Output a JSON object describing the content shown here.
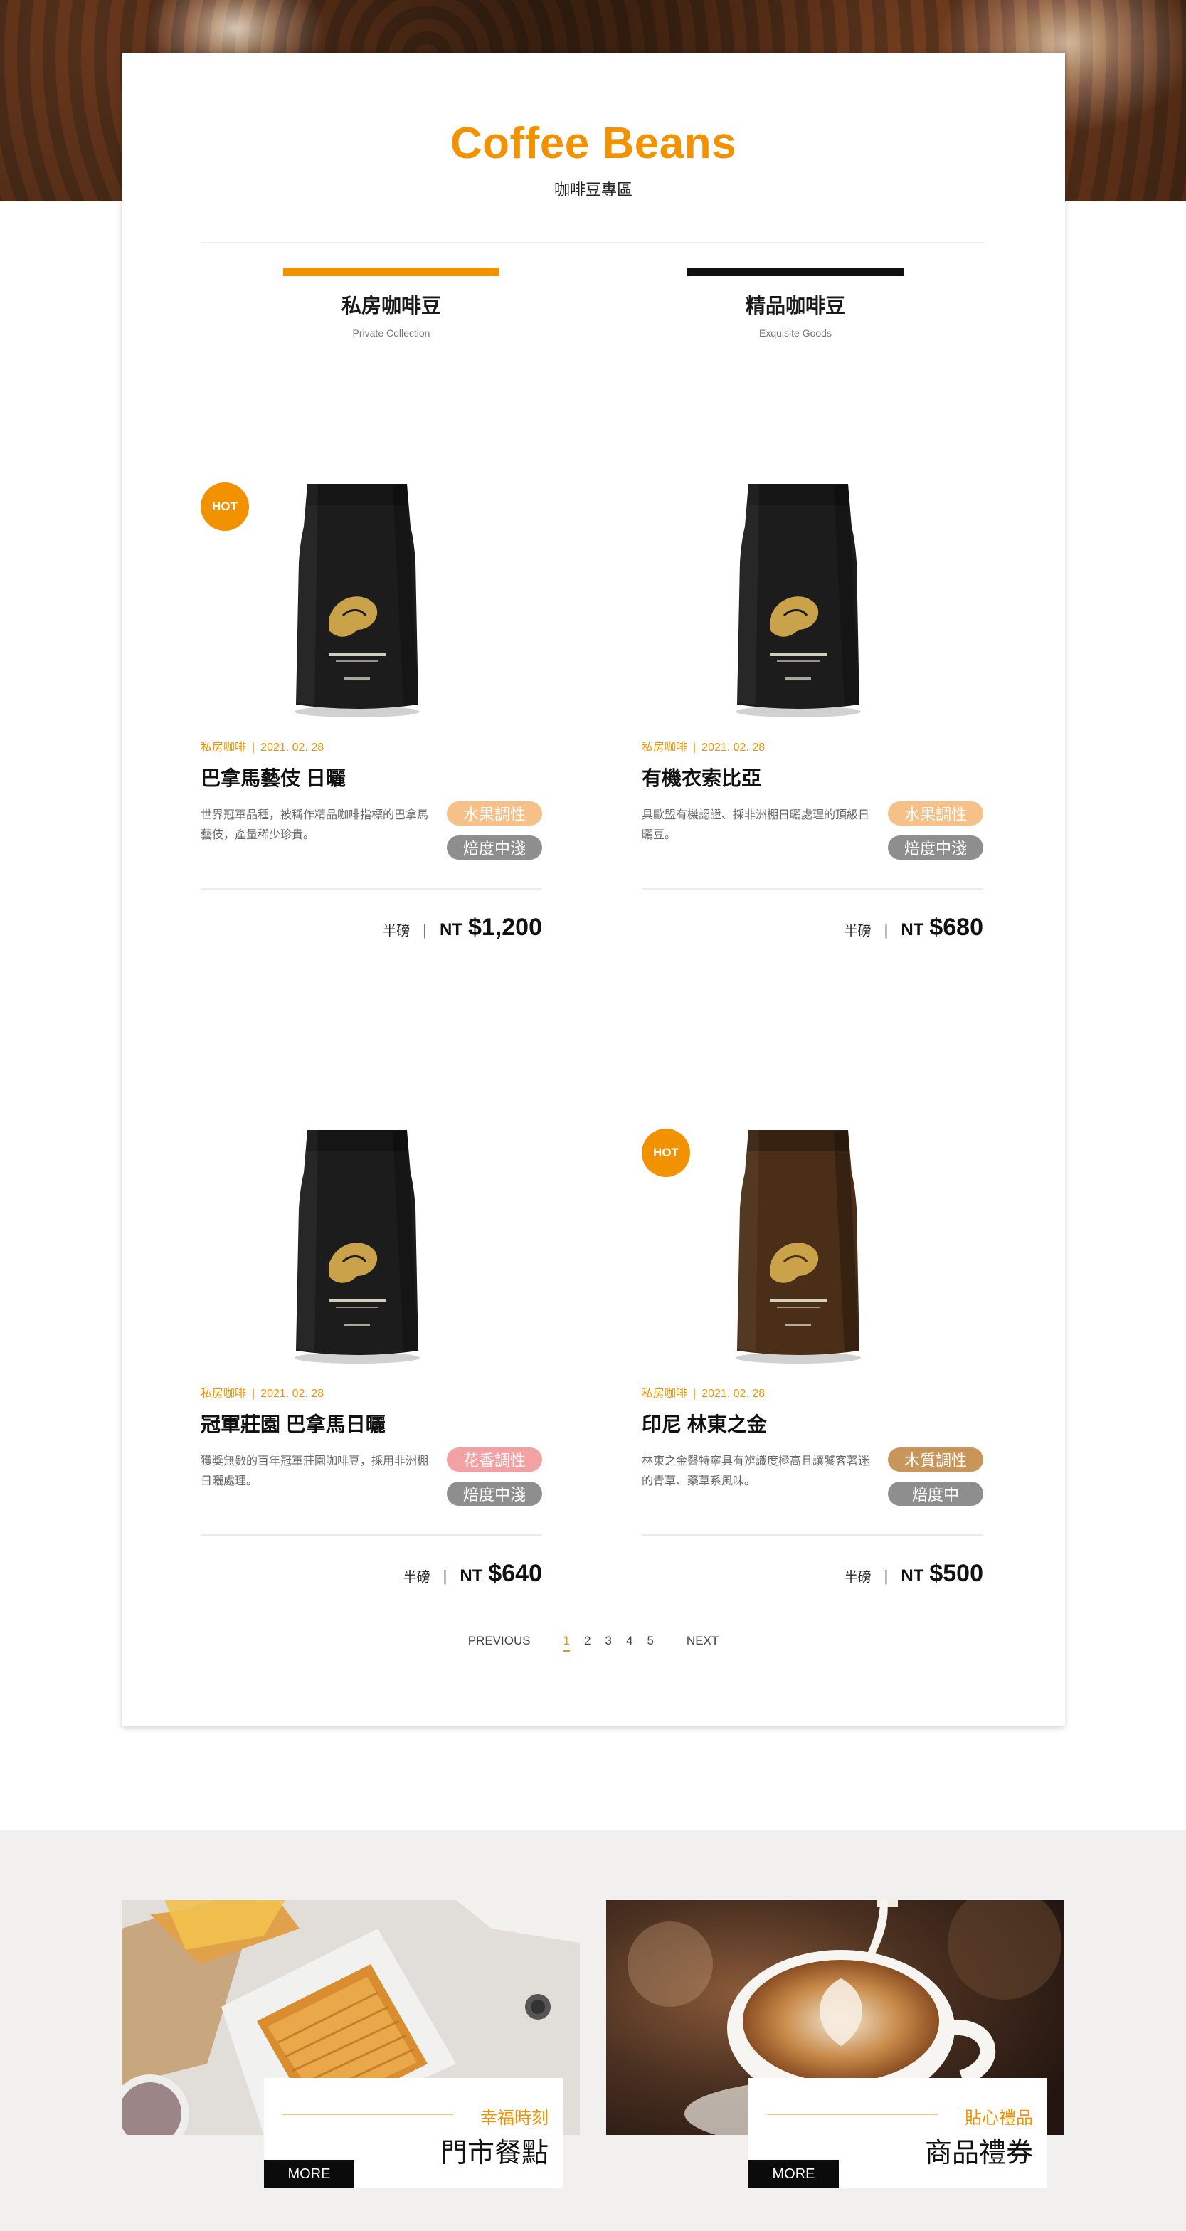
{
  "header": {
    "title": "Coffee Beans",
    "subtitle": "咖啡豆專區"
  },
  "tabs": [
    {
      "title": "私房咖啡豆",
      "subtitle": "Private Collection"
    },
    {
      "title": "精品咖啡豆",
      "subtitle": "Exquisite Goods"
    }
  ],
  "products": [
    {
      "badge": "HOT",
      "category": "私房咖啡",
      "date": "2021. 02. 28",
      "name": "巴拿馬藝伎 日曬",
      "description": "世界冠軍品種，被稱作精品咖啡指標的巴拿馬藝伎，產量稀少珍貴。",
      "tag1": "水果調性",
      "tag2": "焙度中淺",
      "unit": "半磅",
      "currency": "NT",
      "price": "$1,200",
      "bag_color": "#1c1c1c"
    },
    {
      "badge": "",
      "category": "私房咖啡",
      "date": "2021. 02. 28",
      "name": "有機衣索比亞",
      "description": "具歐盟有機認證、採非洲棚日曬處理的頂級日曬豆。",
      "tag1": "水果調性",
      "tag2": "焙度中淺",
      "unit": "半磅",
      "currency": "NT",
      "price": "$680",
      "bag_color": "#1c1c1c"
    },
    {
      "badge": "",
      "category": "私房咖啡",
      "date": "2021. 02. 28",
      "name": "冠軍莊園 巴拿馬日曬",
      "description": "獲獎無數的百年冠軍莊園咖啡豆，採用非洲棚日曬處理。",
      "tag1": "花香調性",
      "tag2": "焙度中淺",
      "unit": "半磅",
      "currency": "NT",
      "price": "$640",
      "bag_color": "#1c1c1c"
    },
    {
      "badge": "HOT",
      "category": "私房咖啡",
      "date": "2021. 02. 28",
      "name": "印尼 林東之金",
      "description": "林東之金醫特寧具有辨識度極高且讓饕客著迷的青草、藥草系風味。",
      "tag1": "木質調性",
      "tag2": "焙度中",
      "unit": "半磅",
      "currency": "NT",
      "price": "$500",
      "bag_color": "#4a2e17"
    }
  ],
  "pagination": {
    "previous": "PREVIOUS",
    "pages": [
      "1",
      "2",
      "3",
      "4",
      "5"
    ],
    "current": "1",
    "next": "NEXT"
  },
  "promos": [
    {
      "kicker": "幸福時刻",
      "heading": "門市餐點",
      "button": "MORE"
    },
    {
      "kicker": "貼心禮品",
      "heading": "商品禮券",
      "button": "MORE"
    }
  ],
  "colors": {
    "accent": "#f39200",
    "tag_fruit": "#f6c189",
    "tag_flower": "#f2a2a2",
    "tag_wood": "#c8965a",
    "tag_roast": "#8e8e8e"
  }
}
